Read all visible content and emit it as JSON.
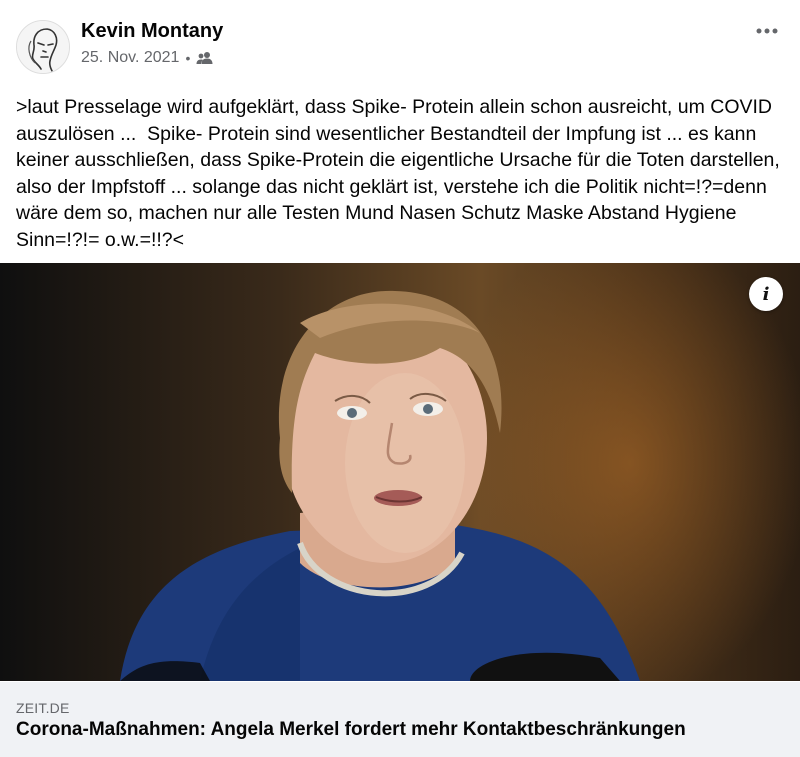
{
  "post": {
    "author": "Kevin Montany",
    "date": "25. Nov. 2021",
    "separator": "•",
    "audience_icon": "friends-icon",
    "more_icon": "more-options-icon",
    "text": ">laut Presselage wird aufgeklärt, dass Spike- Protein allein schon ausreicht, um COVID auszulösen ...  Spike- Protein sind wesentlicher Bestandteil der Impfung ist ... es kann keiner ausschließen, dass Spike-Protein die eigentliche Ursache für die Toten darstellen, also der Impfstoff ... solange das nicht geklärt ist, verstehe ich die Politik nicht=!?=denn wäre dem so, machen nur alle Testen Mund Nasen Schutz Maske Abstand Hygiene Sinn=!?!= o.w.=!!?<"
  },
  "link": {
    "domain": "ZEIT.DE",
    "title": "Corona-Maßnahmen: Angela Merkel fordert mehr Kontaktbeschränkungen",
    "info_label": "i"
  }
}
